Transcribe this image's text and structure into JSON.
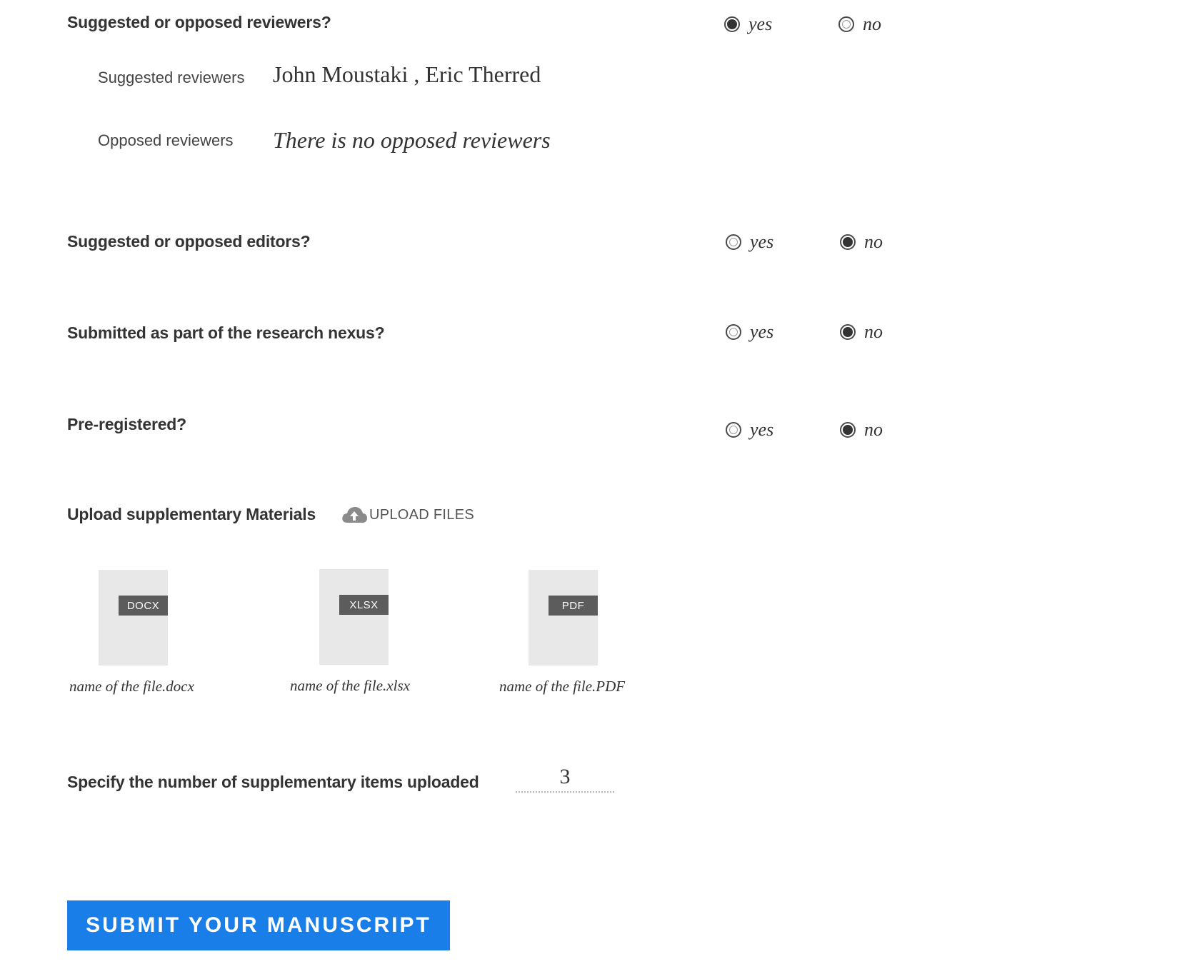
{
  "reviewers": {
    "question": "Suggested or opposed reviewers?",
    "yes_label": "yes",
    "no_label": "no",
    "selected": "yes",
    "suggested_label": "Suggested reviewers",
    "suggested_value": "John Moustaki , Eric Therred",
    "opposed_label": "Opposed reviewers",
    "opposed_value": "There is no opposed reviewers"
  },
  "editors": {
    "question": "Suggested or opposed editors?",
    "yes_label": "yes",
    "no_label": "no",
    "selected": "no"
  },
  "nexus": {
    "question": "Submitted as part of the research nexus?",
    "yes_label": "yes",
    "no_label": "no",
    "selected": "no"
  },
  "preregistered": {
    "question": "Pre-registered?",
    "yes_label": "yes",
    "no_label": "no",
    "selected": "no"
  },
  "supplementary": {
    "title": "Upload supplementary Materials",
    "upload_label": "UPLOAD FILES",
    "upload_icon": "cloud-upload-icon",
    "files": [
      {
        "type": "DOCX",
        "name": "name of the file.docx"
      },
      {
        "type": "XLSX",
        "name": "name of the file.xlsx"
      },
      {
        "type": "PDF",
        "name": "name of the file.PDF"
      }
    ]
  },
  "count": {
    "label": "Specify the number of supplementary items uploaded",
    "value": "3"
  },
  "submit": {
    "label": "SUBMIT YOUR MANUSCRIPT"
  },
  "colors": {
    "accent": "#1a7ee8",
    "text": "#333333",
    "file_bg": "#e8e8e8",
    "file_tag": "#5c5c5c"
  }
}
